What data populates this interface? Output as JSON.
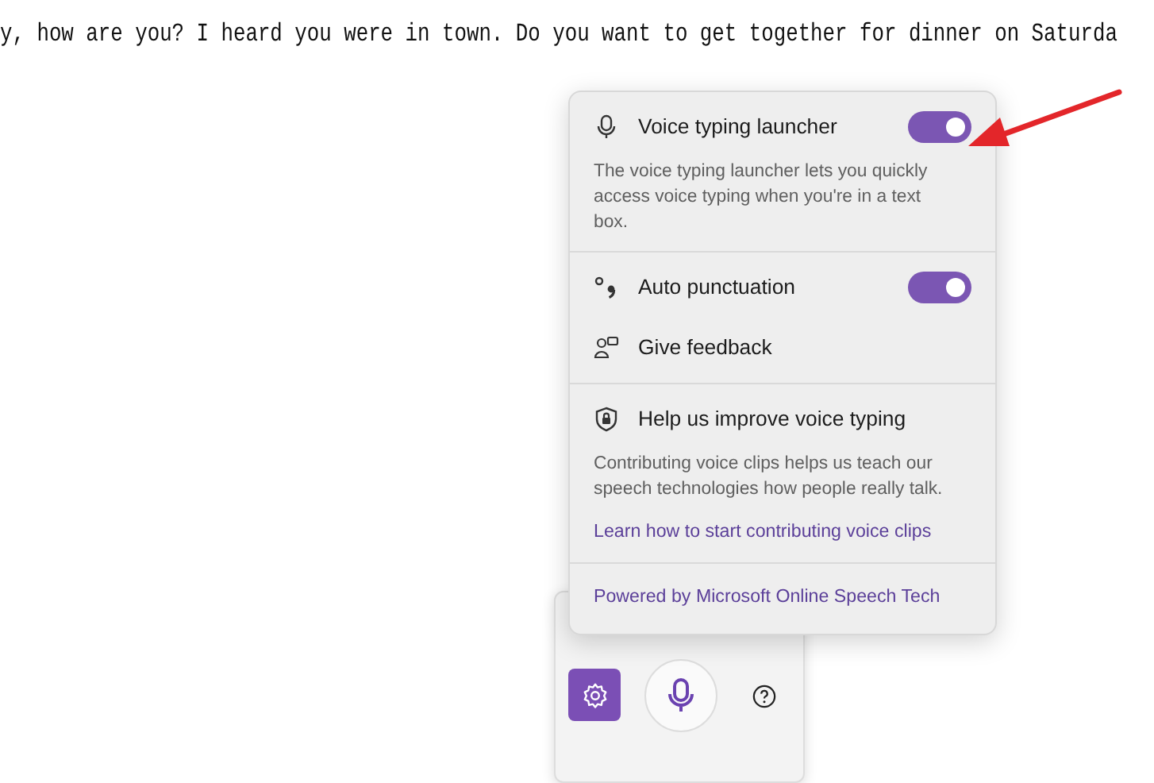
{
  "editor": {
    "text": "y, how are you? I heard you were in town. Do you want to get together for dinner on Saturda"
  },
  "flyout": {
    "sections": [
      {
        "kind": "toggle",
        "label": "Voice typing launcher",
        "on": true,
        "description": "The voice typing launcher lets you quickly access voice typing when you're in a text box."
      },
      {
        "kind": "toggle",
        "label": "Auto punctuation",
        "on": true
      },
      {
        "kind": "action",
        "label": "Give feedback"
      },
      {
        "kind": "info",
        "label": "Help us improve voice typing",
        "description": "Contributing voice clips helps us teach our speech technologies how people really talk.",
        "link": "Learn how to start contributing voice clips"
      }
    ],
    "footer_link": "Powered by Microsoft Online Speech Tech"
  },
  "toolbar": {
    "settings_selected": true
  }
}
